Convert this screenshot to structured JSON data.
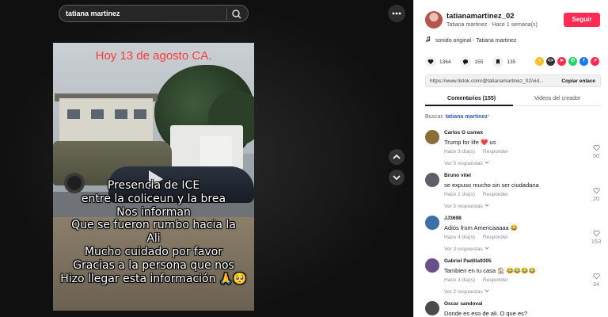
{
  "search": {
    "query": "tatiana martinez"
  },
  "video": {
    "overlay_title": "Hoy 13 de agosto CA.",
    "caption_lines": [
      "Presencia de ICE",
      "entre la coliceun y la brea",
      "Nos informan",
      "Que se fueron rumbo hacia la",
      "Ali",
      "Mucho cuidado por favor",
      "Gracias a la persona que nos",
      "Hizo llegar esta información 🙏🥺"
    ]
  },
  "author": {
    "username": "tatianamartinez_02",
    "display_name": "Tatiana martinez",
    "posted": "Hace 1 semana(s)",
    "follow_label": "Seguir"
  },
  "music": {
    "text": "sonido original - Tatiana martinez"
  },
  "stats": {
    "likes": "1364",
    "comments": "155",
    "saves": "135"
  },
  "share_icons": [
    {
      "name": "embed",
      "color": "#f6c026",
      "glyph": "•"
    },
    {
      "name": "code",
      "color": "#333333",
      "glyph": "<>"
    },
    {
      "name": "send",
      "color": "#fe2c55",
      "glyph": "➤"
    },
    {
      "name": "whatsapp",
      "color": "#25d366",
      "glyph": "✆"
    },
    {
      "name": "facebook",
      "color": "#1877f2",
      "glyph": "f"
    },
    {
      "name": "share-arrow",
      "color": "#fe2c55",
      "glyph": "↗"
    }
  ],
  "link": {
    "url": "https://www.tiktok.com/@tatianamartinez_02/vid...",
    "copy_label": "Copiar enlace"
  },
  "tabs": {
    "comments": "Comentarios (155)",
    "creator": "Videos del creador"
  },
  "comments_search": {
    "prefix": "Buscar:",
    "query": "tatiana martinez"
  },
  "comments": [
    {
      "name": "Carlos G usnwx",
      "text": "Trump for life ❤️ us",
      "date": "Hace 3 día(s)",
      "reply": "Responder",
      "replies": "Ver 5 respuestas",
      "likes": "50",
      "avatar_color": "#8a6d3b"
    },
    {
      "name": "Bruno vitel",
      "text": "se expuso mucho sin ser ciudadana",
      "date": "Hace 2 día(s)",
      "reply": "Responder",
      "replies": "Ver 5 respuestas",
      "likes": "20",
      "avatar_color": "#5c5f66"
    },
    {
      "name": "JJ3698",
      "text": "Adiós from Americaaaaa 😂",
      "date": "Hace 4 día(s)",
      "reply": "Responder",
      "replies": "Ver 3 respuestas",
      "likes": "153",
      "avatar_color": "#3b6fa8"
    },
    {
      "name": "Gabriel Padilla9305",
      "text": "Tambien en tu casa 🏠 😂😂😂😂",
      "date": "Hace 3 día(s)",
      "reply": "Responder",
      "replies": "Ver 2 respuestas",
      "likes": "34",
      "avatar_color": "#6a4e8a"
    },
    {
      "name": "Oscar sandoval",
      "text": "Donde es eso de ali. O que es?",
      "date": "",
      "reply": "",
      "replies": "",
      "likes": "",
      "avatar_color": "#4a4a4a"
    }
  ]
}
